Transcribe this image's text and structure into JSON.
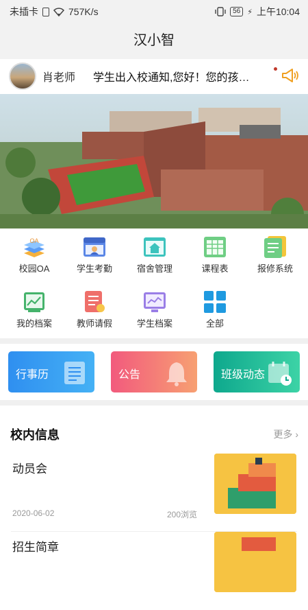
{
  "status_bar": {
    "carrier": "未插卡",
    "speed": "757K/s",
    "battery": "56",
    "time": "上午10:04"
  },
  "app_title": "汉小智",
  "notice": {
    "teacher_name": "肖老师",
    "text": "学生出入校通知,您好！您的孩…"
  },
  "grid": [
    {
      "label": "校园OA",
      "icon": "oa-stack-icon"
    },
    {
      "label": "学生考勤",
      "icon": "attendance-icon"
    },
    {
      "label": "宿舍管理",
      "icon": "dormitory-icon"
    },
    {
      "label": "课程表",
      "icon": "timetable-icon"
    },
    {
      "label": "报修系统",
      "icon": "repair-icon"
    },
    {
      "label": "我的档案",
      "icon": "my-file-chart-icon"
    },
    {
      "label": "教师请假",
      "icon": "leave-icon"
    },
    {
      "label": "学生档案",
      "icon": "student-file-icon"
    },
    {
      "label": "全部",
      "icon": "all-apps-icon"
    }
  ],
  "oa_badge": "OA",
  "cards": [
    {
      "label": "行事历",
      "color_from": "#2f8ff0",
      "color_to": "#45b1f5"
    },
    {
      "label": "公告",
      "color_from": "#f25a7d",
      "color_to": "#f7a072"
    },
    {
      "label": "班级动态",
      "color_from": "#0ea88d",
      "color_to": "#3dd3a6"
    }
  ],
  "news": {
    "title": "校内信息",
    "more": "更多",
    "items": [
      {
        "title": "动员会",
        "date": "2020-06-02",
        "views": "200浏览"
      },
      {
        "title": "招生简章",
        "date": "",
        "views": ""
      }
    ]
  }
}
